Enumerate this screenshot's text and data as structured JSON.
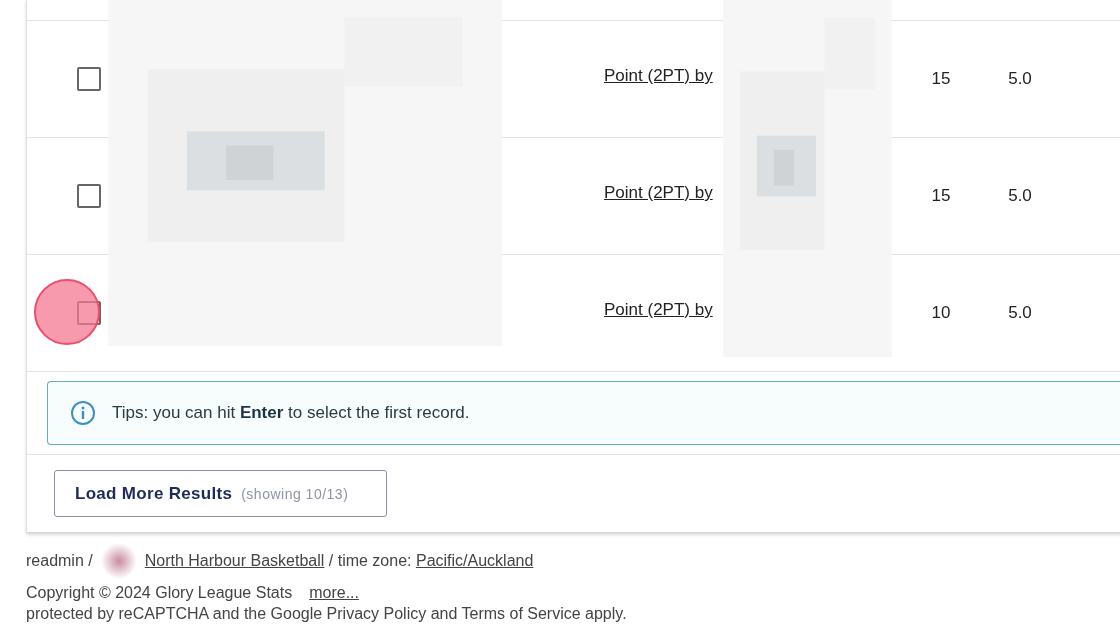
{
  "table": {
    "rows": [
      {
        "checked": false,
        "highlighted": false,
        "link": "Point (2PT) by",
        "column_4": "15",
        "column_5": "5.0"
      },
      {
        "checked": false,
        "highlighted": false,
        "link": "Point (2PT) by",
        "column_4": "15",
        "column_5": "5.0"
      },
      {
        "checked": false,
        "highlighted": true,
        "link": "Point (2PT) by",
        "column_4": "10",
        "column_5": "5.0"
      }
    ]
  },
  "tip": {
    "text": "Tips: you can hit **Enter** to select the first record."
  },
  "load_more": {
    "label": "Load More Results",
    "count": "(showing 10/13)"
  },
  "footer": {
    "user": "readmin /",
    "club": "North Harbour Basketball",
    "timezone_label": "/ time zone:",
    "timezone": "Pacific/Auckland",
    "copyright": "Copyright © 2024 Glory League Stats",
    "more": "more...",
    "recaptcha": "protected by reCAPTCHA and the Google Privacy Policy and Terms of Service apply."
  }
}
